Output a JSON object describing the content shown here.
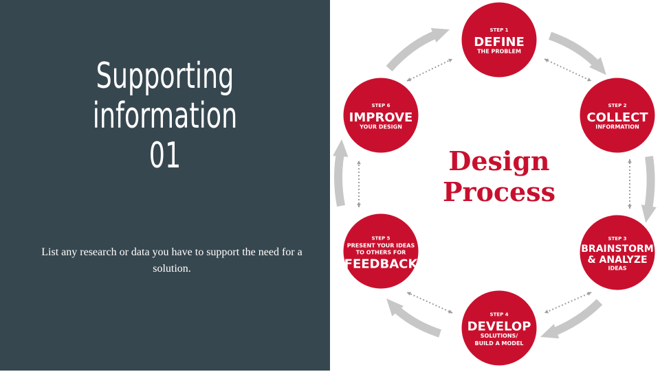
{
  "slide": {
    "title_lines": [
      "Supporting",
      "information",
      "01"
    ],
    "body": "List any research or data you have to support the need for a solution."
  },
  "diagram": {
    "center_lines": [
      "Design",
      "Process"
    ],
    "steps": [
      {
        "step": "STEP 1",
        "lines": [
          "DEFINE"
        ],
        "sub": [
          "THE PROBLEM"
        ]
      },
      {
        "step": "STEP 2",
        "lines": [
          "COLLECT"
        ],
        "sub": [
          "INFORMATION"
        ]
      },
      {
        "step": "STEP 3",
        "lines": [
          "BRAINSTORM",
          "& ANALYZE"
        ],
        "sub": [
          "IDEAS"
        ]
      },
      {
        "step": "STEP 4",
        "lines": [
          "DEVELOP"
        ],
        "sub": [
          "SOLUTIONS/",
          "BUILD A MODEL"
        ]
      },
      {
        "step": "STEP 5",
        "lines": [
          "FEEDBACK"
        ],
        "pre": [
          "PRESENT YOUR IDEAS",
          "TO OTHERS FOR"
        ]
      },
      {
        "step": "STEP 6",
        "lines": [
          "IMPROVE"
        ],
        "sub": [
          "YOUR DESIGN"
        ]
      }
    ],
    "colors": {
      "circle": "#c8102e",
      "arrow": "#c7c7c7",
      "dotted": "#9e9e9e",
      "center_text": "#c8102e"
    }
  }
}
